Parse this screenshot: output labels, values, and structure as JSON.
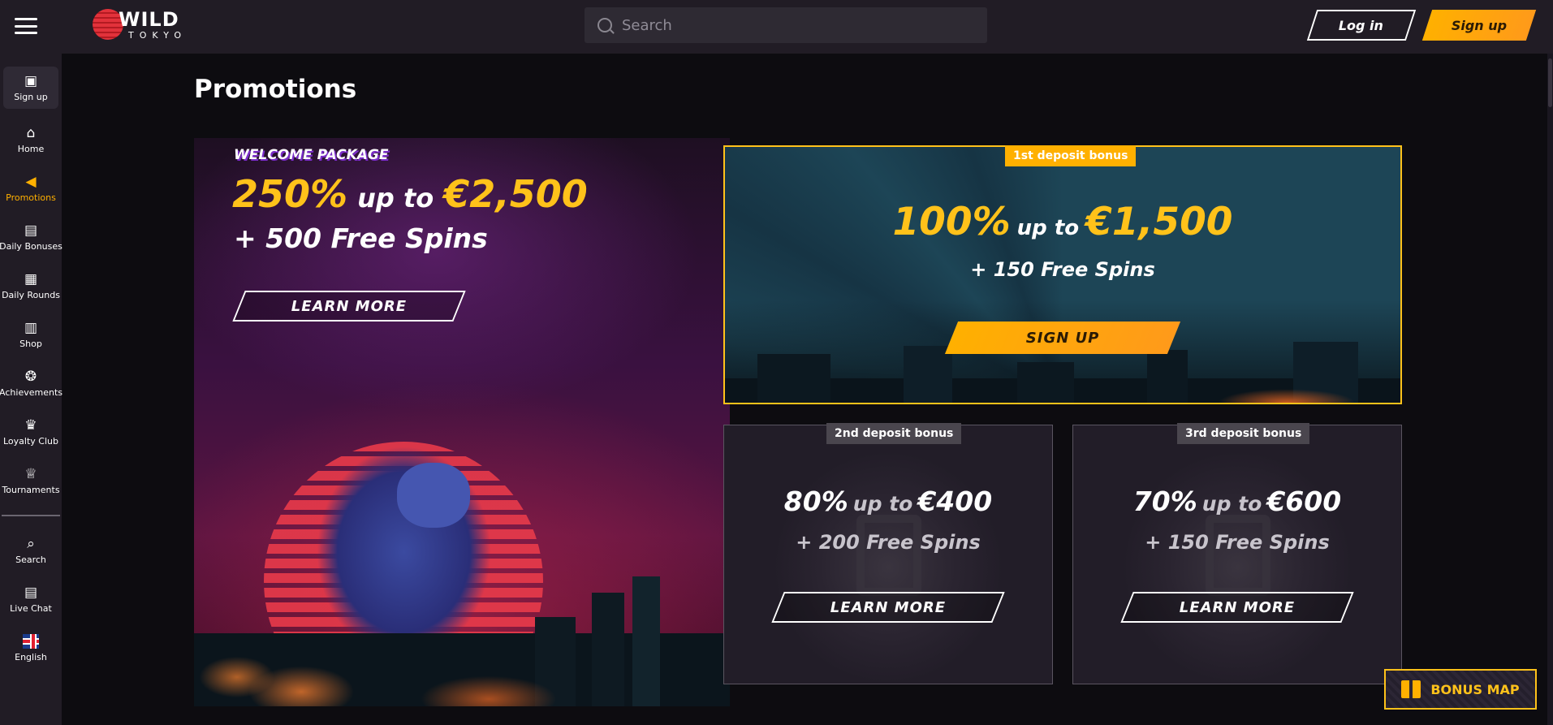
{
  "header": {
    "logo_text": "WILD",
    "logo_sub": "TOKYO",
    "search_placeholder": "Search",
    "login_label": "Log in",
    "signup_label": "Sign up"
  },
  "sidebar": {
    "items": [
      {
        "label": "Sign up",
        "icon": "signup-icon"
      },
      {
        "label": "Home",
        "icon": "home-icon"
      },
      {
        "label": "Promotions",
        "icon": "megaphone-icon",
        "active": true
      },
      {
        "label": "Daily Bonuses",
        "icon": "gift-icon"
      },
      {
        "label": "Daily Rounds",
        "icon": "calendar-icon"
      },
      {
        "label": "Shop",
        "icon": "shop-icon"
      },
      {
        "label": "Achievements",
        "icon": "medal-icon"
      },
      {
        "label": "Loyalty Club",
        "icon": "crown-icon"
      },
      {
        "label": "Tournaments",
        "icon": "trophy-icon"
      },
      {
        "label": "Search",
        "icon": "search-icon"
      },
      {
        "label": "Live Chat",
        "icon": "chat-icon"
      },
      {
        "label": "English",
        "icon": "uk-flag-icon"
      }
    ],
    "active_color": "#ffb000"
  },
  "main": {
    "page_title": "Promotions",
    "welcome": {
      "label": "WELCOME PACKAGE",
      "percent": "250%",
      "upto": "up to",
      "amount": "€2,500",
      "spins": "+ 500 Free Spins",
      "button": "LEARN MORE"
    },
    "cards": [
      {
        "tag": "1st deposit bonus",
        "percent": "100%",
        "upto": "up to",
        "amount": "€1,500",
        "spins": "+ 150 Free Spins",
        "button": "SIGN UP"
      },
      {
        "tag": "2nd deposit bonus",
        "percent": "80%",
        "upto": "up to",
        "amount": "€400",
        "spins": "+ 200 Free Spins",
        "button": "LEARN MORE"
      },
      {
        "tag": "3rd deposit bonus",
        "percent": "70%",
        "upto": "up to",
        "amount": "€600",
        "spins": "+ 150 Free Spins",
        "button": "LEARN MORE"
      }
    ]
  },
  "bonus_map_label": "BONUS MAP",
  "colors": {
    "accent": "#ffc21a",
    "button_gold": "#ffb000",
    "topbar_bg": "#211c25",
    "page_bg": "#0d0c10"
  }
}
